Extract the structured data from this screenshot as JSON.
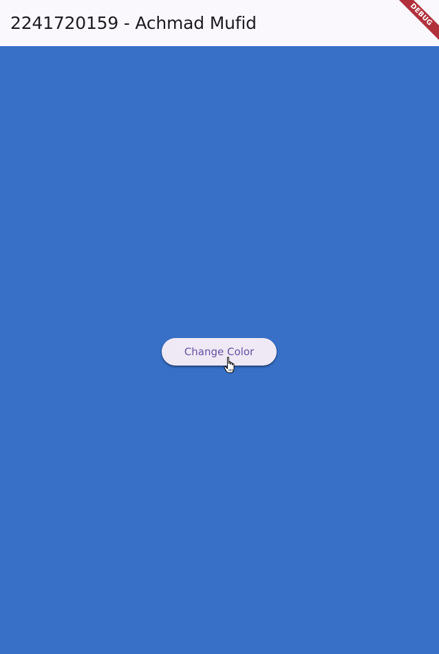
{
  "app_bar": {
    "title": "2241720159 - Achmad Mufid"
  },
  "body": {
    "background_color": "#3870c8"
  },
  "button": {
    "label": "Change Color",
    "text_color": "#6750a4",
    "background_color": "#efe9f5"
  },
  "debug_banner": {
    "label": "DEBUG",
    "color": "#b0313c"
  },
  "cursor": {
    "icon": "hand-pointer-icon"
  }
}
